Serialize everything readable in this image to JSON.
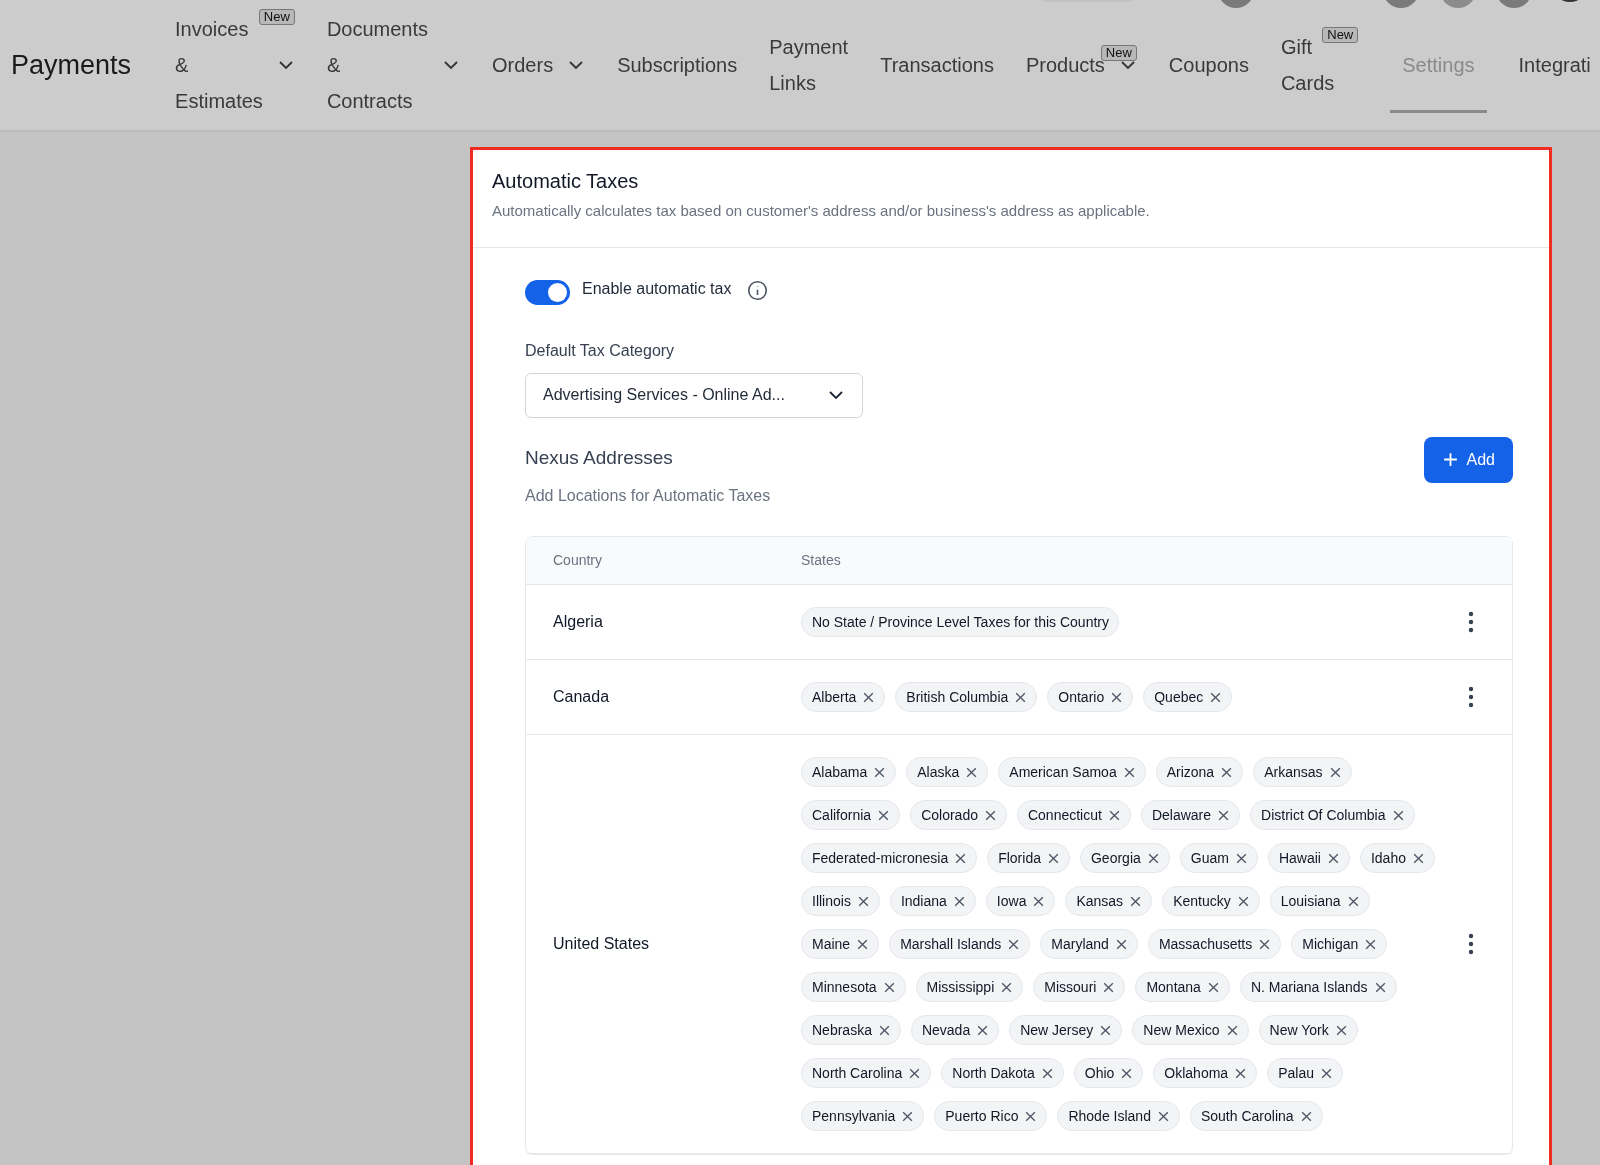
{
  "app_title": "Payments",
  "nav": [
    {
      "lines": [
        "Invoices",
        "&",
        "Estimates"
      ],
      "dropdown": true,
      "badge": "New",
      "selected": false
    },
    {
      "lines": [
        "Documents",
        "&",
        "Contracts"
      ],
      "dropdown": true,
      "selected": false
    },
    {
      "lines": [
        "Orders"
      ],
      "dropdown": true,
      "selected": false
    },
    {
      "lines": [
        "Subscriptions"
      ],
      "dropdown": false,
      "selected": false
    },
    {
      "lines": [
        "Payment",
        "Links"
      ],
      "dropdown": false,
      "selected": false
    },
    {
      "lines": [
        "Transactions"
      ],
      "dropdown": false,
      "selected": false
    },
    {
      "lines": [
        "Products"
      ],
      "dropdown": true,
      "badge": "New",
      "selected": false
    },
    {
      "lines": [
        "Coupons"
      ],
      "dropdown": false,
      "selected": false
    },
    {
      "lines": [
        "Gift",
        "Cards"
      ],
      "dropdown": false,
      "badge": "New",
      "selected": false
    },
    {
      "lines": [
        "Settings"
      ],
      "dropdown": false,
      "selected": true
    },
    {
      "lines": [
        "Integrati"
      ],
      "dropdown": false,
      "selected": false
    }
  ],
  "card": {
    "title": "Automatic Taxes",
    "description": "Automatically calculates tax based on customer's address and/or business's address as applicable.",
    "toggle": {
      "label": "Enable automatic tax",
      "on": true
    },
    "default_tax_category": {
      "label": "Default Tax Category",
      "value": "Advertising Services - Online Ad..."
    },
    "nexus": {
      "title": "Nexus Addresses",
      "subtitle": "Add Locations for Automatic Taxes",
      "add_button": "Add",
      "table": {
        "columns": [
          "Country",
          "States"
        ],
        "rows": [
          {
            "country": "Algeria",
            "states": [
              {
                "label": "No State / Province Level Taxes for this Country",
                "removable": false
              }
            ]
          },
          {
            "country": "Canada",
            "states": [
              {
                "label": "Alberta",
                "removable": true
              },
              {
                "label": "British Columbia",
                "removable": true
              },
              {
                "label": "Ontario",
                "removable": true
              },
              {
                "label": "Quebec",
                "removable": true
              }
            ]
          },
          {
            "country": "United States",
            "states": [
              {
                "label": "Alabama",
                "removable": true
              },
              {
                "label": "Alaska",
                "removable": true
              },
              {
                "label": "American Samoa",
                "removable": true
              },
              {
                "label": "Arizona",
                "removable": true
              },
              {
                "label": "Arkansas",
                "removable": true
              },
              {
                "label": "California",
                "removable": true
              },
              {
                "label": "Colorado",
                "removable": true
              },
              {
                "label": "Connecticut",
                "removable": true
              },
              {
                "label": "Delaware",
                "removable": true
              },
              {
                "label": "District Of Columbia",
                "removable": true
              },
              {
                "label": "Federated-micronesia",
                "removable": true
              },
              {
                "label": "Florida",
                "removable": true
              },
              {
                "label": "Georgia",
                "removable": true
              },
              {
                "label": "Guam",
                "removable": true
              },
              {
                "label": "Hawaii",
                "removable": true
              },
              {
                "label": "Idaho",
                "removable": true
              },
              {
                "label": "Illinois",
                "removable": true
              },
              {
                "label": "Indiana",
                "removable": true
              },
              {
                "label": "Iowa",
                "removable": true
              },
              {
                "label": "Kansas",
                "removable": true
              },
              {
                "label": "Kentucky",
                "removable": true
              },
              {
                "label": "Louisiana",
                "removable": true
              },
              {
                "label": "Maine",
                "removable": true
              },
              {
                "label": "Marshall Islands",
                "removable": true
              },
              {
                "label": "Maryland",
                "removable": true
              },
              {
                "label": "Massachusetts",
                "removable": true
              },
              {
                "label": "Michigan",
                "removable": true
              },
              {
                "label": "Minnesota",
                "removable": true
              },
              {
                "label": "Mississippi",
                "removable": true
              },
              {
                "label": "Missouri",
                "removable": true
              },
              {
                "label": "Montana",
                "removable": true
              },
              {
                "label": "N. Mariana Islands",
                "removable": true
              },
              {
                "label": "Nebraska",
                "removable": true
              },
              {
                "label": "Nevada",
                "removable": true
              },
              {
                "label": "New Jersey",
                "removable": true
              },
              {
                "label": "New Mexico",
                "removable": true
              },
              {
                "label": "New York",
                "removable": true
              },
              {
                "label": "North Carolina",
                "removable": true
              },
              {
                "label": "North Dakota",
                "removable": true
              },
              {
                "label": "Ohio",
                "removable": true
              },
              {
                "label": "Oklahoma",
                "removable": true
              },
              {
                "label": "Palau",
                "removable": true
              },
              {
                "label": "Pennsylvania",
                "removable": true
              },
              {
                "label": "Puerto Rico",
                "removable": true
              },
              {
                "label": "Rhode Island",
                "removable": true
              },
              {
                "label": "South Carolina",
                "removable": true
              }
            ]
          }
        ]
      }
    }
  }
}
